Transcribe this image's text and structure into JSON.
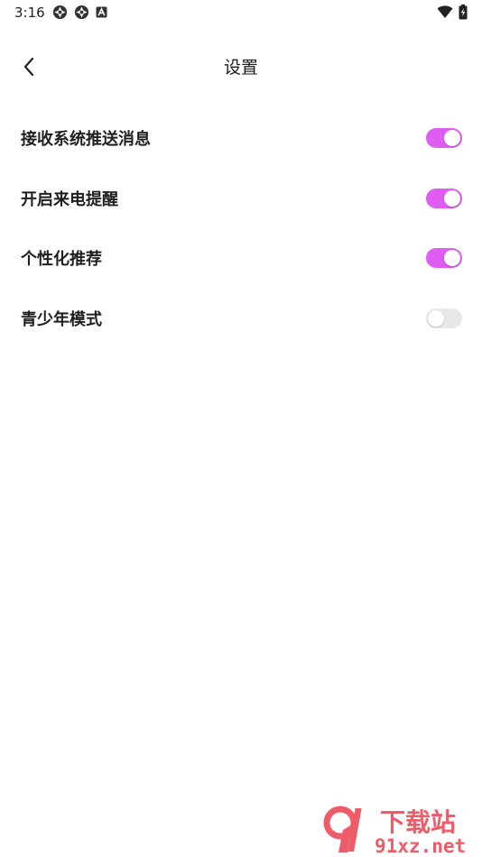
{
  "status_bar": {
    "time": "3:16",
    "left_icons": [
      "app-notification-icon",
      "app-notification-icon",
      "font-a-icon"
    ],
    "right_icons": [
      "wifi-icon",
      "battery-charging-icon"
    ]
  },
  "header": {
    "title": "设置",
    "back_icon": "chevron-left-icon"
  },
  "settings": [
    {
      "label": "接收系统推送消息",
      "enabled": true
    },
    {
      "label": "开启来电提醒",
      "enabled": true
    },
    {
      "label": "个性化推荐",
      "enabled": true
    },
    {
      "label": "青少年模式",
      "enabled": false
    }
  ],
  "colors": {
    "toggle_on": "#e05cf2",
    "toggle_off": "#e8e8e8",
    "watermark": "#e9414f"
  },
  "watermark": {
    "logo_text": "9",
    "title": "下载站",
    "domain": "91xz.net"
  }
}
